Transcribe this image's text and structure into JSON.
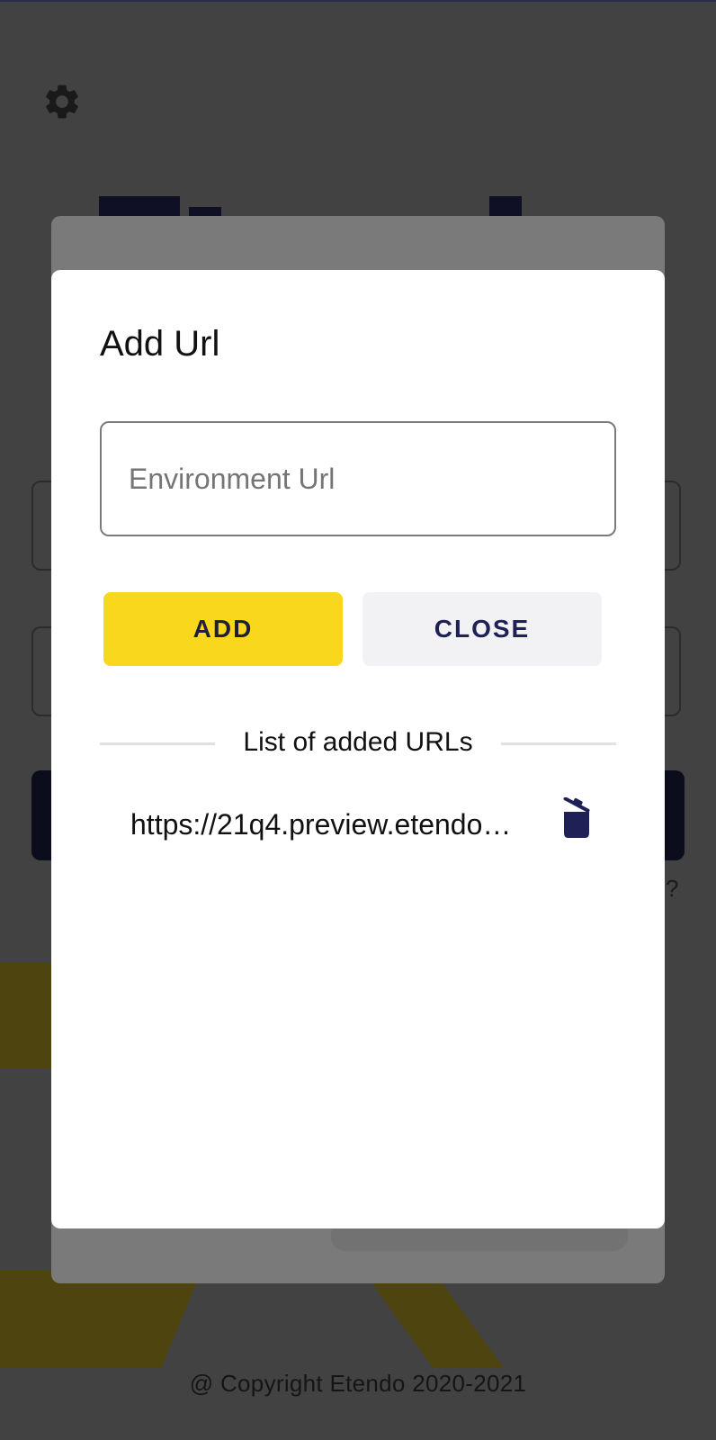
{
  "background": {
    "copyright": "@ Copyright Etendo 2020-2021",
    "help_fragment": "?"
  },
  "modal": {
    "title": "Add Url",
    "input": {
      "placeholder": "Environment Url",
      "value": ""
    },
    "add_button": "ADD",
    "close_button": "CLOSE",
    "list_header": "List of added URLs",
    "urls": [
      {
        "display": "https://21q4.preview.etendo…"
      }
    ]
  },
  "colors": {
    "accent_yellow": "#f9d71c",
    "brand_navy": "#1f2056"
  },
  "icons": {
    "settings": "gear-icon",
    "delete": "trash-icon"
  }
}
